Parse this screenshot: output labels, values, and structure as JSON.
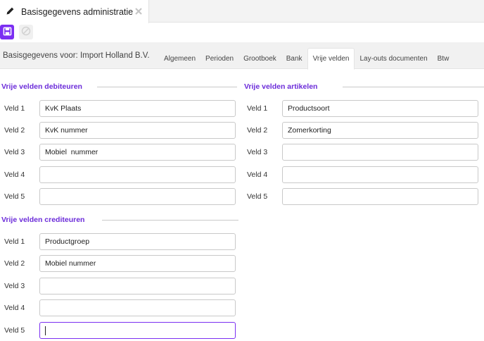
{
  "window": {
    "tab_title": "Basisgegevens administratie",
    "tab_icon": "pencil-icon",
    "close_icon": "close-icon"
  },
  "toolbar": {
    "save_icon": "save-icon",
    "cancel_icon": "cancel-icon",
    "accent": "#7b2ff2"
  },
  "company": {
    "label": "Basisgegevens voor: Import Holland B.V."
  },
  "tabs": [
    {
      "label": "Algemeen",
      "active": false
    },
    {
      "label": "Perioden",
      "active": false
    },
    {
      "label": "Grootboek",
      "active": false
    },
    {
      "label": "Bank",
      "active": false
    },
    {
      "label": "Vrije velden",
      "active": true
    },
    {
      "label": "Lay-outs documenten",
      "active": false
    },
    {
      "label": "Btw",
      "active": false
    }
  ],
  "debiteuren": {
    "title": "Vrije velden debiteuren",
    "fields": [
      {
        "label": "Veld 1",
        "value": "KvK Plaats"
      },
      {
        "label": "Veld 2",
        "value": "KvK nummer"
      },
      {
        "label": "Veld 3",
        "value": "Mobiel  nummer"
      },
      {
        "label": "Veld 4",
        "value": ""
      },
      {
        "label": "Veld 5",
        "value": ""
      }
    ]
  },
  "artikelen": {
    "title": "Vrije velden artikelen",
    "fields": [
      {
        "label": "Veld 1",
        "value": "Productsoort"
      },
      {
        "label": "Veld 2",
        "value": "Zomerkorting"
      },
      {
        "label": "Veld 3",
        "value": ""
      },
      {
        "label": "Veld 4",
        "value": ""
      },
      {
        "label": "Veld 5",
        "value": ""
      }
    ]
  },
  "crediteuren": {
    "title": "Vrije velden crediteuren",
    "fields": [
      {
        "label": "Veld 1",
        "value": "Productgroep"
      },
      {
        "label": "Veld 2",
        "value": "Mobiel nummer"
      },
      {
        "label": "Veld 3",
        "value": ""
      },
      {
        "label": "Veld 4",
        "value": ""
      },
      {
        "label": "Veld 5",
        "value": ""
      }
    ]
  }
}
